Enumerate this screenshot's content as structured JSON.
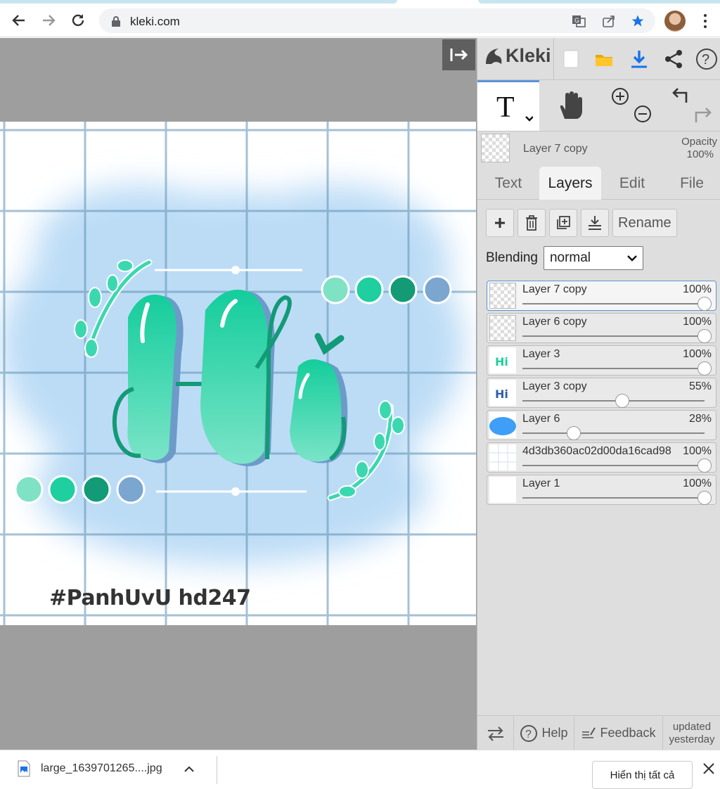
{
  "browser": {
    "url": "kleki.com"
  },
  "canvas": {
    "hashtag": "#PanhUvU   hd247",
    "title_glyph": "Hi",
    "colors": {
      "mint": "#6fe0c0",
      "teal": "#1fcf9f",
      "dark_teal": "#139a77",
      "blue": "#7aa6cf",
      "sky": "#bcdcf6"
    }
  },
  "panel": {
    "logo_text": "Kleki",
    "current_layer": {
      "name": "Layer 7 copy",
      "opacity_label": "Opacity",
      "opacity_value": "100%"
    },
    "tabs": [
      "Text",
      "Layers",
      "Edit",
      "File"
    ],
    "active_tab": "Layers",
    "actions": {
      "rename": "Rename"
    },
    "blending": {
      "label": "Blending",
      "value": "normal"
    },
    "layers": [
      {
        "name": "Layer 7 copy",
        "opacity": "100%",
        "level": 1.0,
        "thumb": "checker",
        "selected": true
      },
      {
        "name": "Layer 6 copy",
        "opacity": "100%",
        "level": 1.0,
        "thumb": "checker",
        "selected": false
      },
      {
        "name": "Layer 3",
        "opacity": "100%",
        "level": 1.0,
        "thumb": "hi-teal",
        "selected": false
      },
      {
        "name": "Layer 3 copy",
        "opacity": "55%",
        "level": 0.55,
        "thumb": "hi-blue",
        "selected": false
      },
      {
        "name": "Layer 6",
        "opacity": "28%",
        "level": 0.28,
        "thumb": "blue-blob",
        "selected": false
      },
      {
        "name": "4d3db360ac02d00da16cad98",
        "opacity": "100%",
        "level": 1.0,
        "thumb": "grid",
        "selected": false
      },
      {
        "name": "Layer 1",
        "opacity": "100%",
        "level": 1.0,
        "thumb": "white",
        "selected": false
      }
    ],
    "footer": {
      "help": "Help",
      "feedback": "Feedback",
      "updated": "updated yesterday"
    }
  },
  "downloads": {
    "file": "large_1639701265....jpg",
    "show_all": "Hiển thị tất cả"
  }
}
